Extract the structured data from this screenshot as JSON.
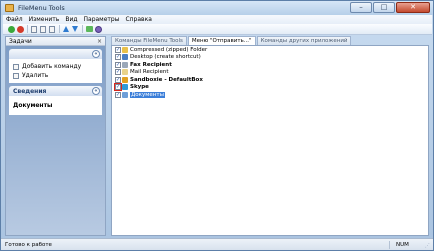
{
  "window": {
    "title": "FileMenu Tools"
  },
  "menubar": {
    "items": [
      "Файл",
      "Изменить",
      "Вид",
      "Параметры",
      "Справка"
    ]
  },
  "toolbar": {
    "buttons": [
      "apply-icon",
      "stop-icon",
      "new-icon",
      "copy-icon",
      "paste-icon",
      "move-up-icon",
      "move-down-icon",
      "green-icon",
      "settings-icon"
    ]
  },
  "left_panel": {
    "header": "Задачи",
    "close_glyph": "×",
    "tasks_group": {
      "toggle": "«",
      "items": [
        {
          "label": "Добавить команду",
          "icon": "add-command-icon"
        },
        {
          "label": "Удалить",
          "icon": "delete-icon"
        }
      ]
    },
    "info_group": {
      "title": "Сведения",
      "toggle": "«",
      "content_title": "Документы"
    }
  },
  "tabs": [
    {
      "label": "Команды FileMenu Tools",
      "active": false
    },
    {
      "label": "Меню \"Отправить...\"",
      "active": true
    },
    {
      "label": "Команды других приложений",
      "active": false
    }
  ],
  "list": {
    "items": [
      {
        "label": "Compressed (zipped) Folder",
        "checked": true,
        "bold": false,
        "icon_color": "#e8c04a"
      },
      {
        "label": "Desktop (create shortcut)",
        "checked": true,
        "bold": false,
        "icon_color": "#4a7fc4"
      },
      {
        "label": "Fax Recipient",
        "checked": true,
        "bold": true,
        "icon_color": "#9aa7b8"
      },
      {
        "label": "Mail Recipient",
        "checked": true,
        "bold": false,
        "icon_color": "#e8d28a"
      },
      {
        "label": "Sandboxie - DefaultBox",
        "checked": true,
        "bold": true,
        "icon_color": "#e0a020"
      },
      {
        "label": "Skype",
        "checked": true,
        "bold": true,
        "icon_color": "#2f9ad8"
      },
      {
        "label": "Документы",
        "checked": true,
        "bold": false,
        "icon_color": "#6e9fd8",
        "selected": true
      }
    ]
  },
  "statusbar": {
    "text": "Готово к работе",
    "num": "NUM"
  }
}
